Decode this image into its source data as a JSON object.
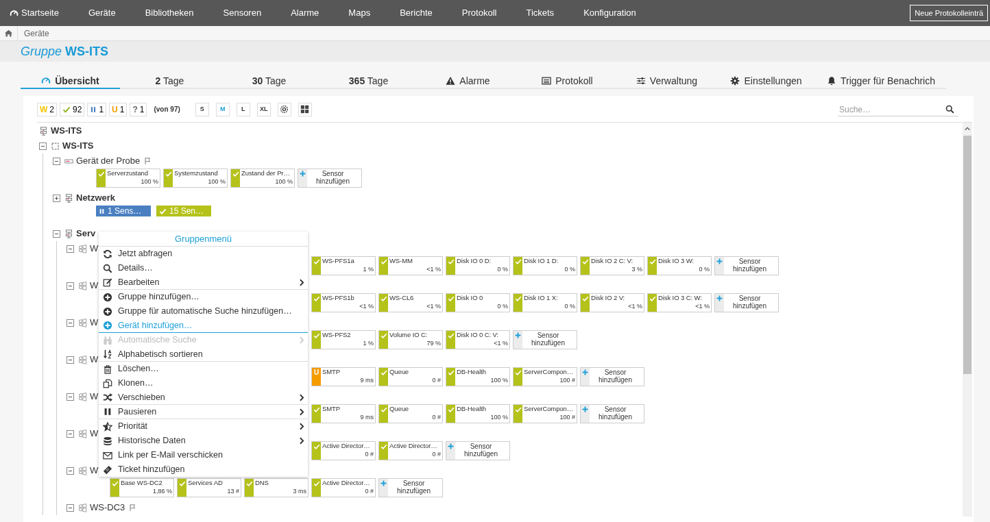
{
  "nav": {
    "home": "Startseite",
    "items": [
      "Geräte",
      "Bibliotheken",
      "Sensoren",
      "Alarme",
      "Maps",
      "Berichte",
      "Protokoll",
      "Tickets",
      "Konfiguration"
    ],
    "button": "Neue Protokolleinträ"
  },
  "breadcrumb": [
    "Geräte"
  ],
  "title": {
    "prefix": "Gruppe",
    "name": "WS-ITS"
  },
  "tabs": [
    {
      "label": "Übersicht",
      "selected": true
    },
    {
      "label": "**2** Tage",
      "selected": false
    },
    {
      "label": "**30** Tage",
      "selected": false
    },
    {
      "label": "**365** Tage",
      "selected": false
    },
    {
      "label": "Alarme",
      "selected": false
    },
    {
      "label": "Protokoll",
      "selected": false
    },
    {
      "label": "Verwaltung",
      "selected": false
    },
    {
      "label": "Einstellungen",
      "selected": false
    },
    {
      "label": "Trigger für Benachrich",
      "selected": false
    }
  ],
  "status_counts": [
    {
      "kind": "warning",
      "letter": "W",
      "count": "2"
    },
    {
      "kind": "ok",
      "count": "92"
    },
    {
      "kind": "paused",
      "count": "1"
    },
    {
      "kind": "unusual",
      "letter": "U",
      "count": "1"
    },
    {
      "kind": "unknown",
      "letter": "?",
      "count": "1"
    }
  ],
  "total": "(von 97)",
  "sizes": [
    {
      "label": "S",
      "selected": false
    },
    {
      "label": "M",
      "selected": true
    },
    {
      "label": "L",
      "selected": false
    },
    {
      "label": "XL",
      "selected": false
    }
  ],
  "search": {
    "placeholder": "Suche…"
  },
  "tree": {
    "kind": "root",
    "label": "WS-ITS",
    "children": [
      {
        "kind": "probe",
        "label": "WS-ITS",
        "expanded": true,
        "children": [
          {
            "kind": "probe_device",
            "label": "Gerät der Probe",
            "flag": true,
            "expanded": true,
            "sensors": [
              {
                "kind": "ok",
                "name": "Serverzustand",
                "value": "100 %"
              },
              {
                "kind": "ok",
                "name": "Systemzustand",
                "value": "100 %"
              },
              {
                "kind": "ok",
                "name": "Zustand der Pr…",
                "value": "100 %"
              },
              {
                "kind": "add",
                "name": "Sensor hinzufügen"
              }
            ]
          },
          {
            "kind": "group",
            "label": "Netzwerk",
            "expanded": false,
            "summary": [
              {
                "kind": "paused",
                "label": "1 Sens…"
              },
              {
                "kind": "ok",
                "label": "15 Sen…"
              }
            ]
          },
          {
            "kind": "group",
            "label": "Serv",
            "expanded": true,
            "children": [
              {
                "kind": "device",
                "label": "W",
                "expanded": true,
                "sensors": [
                  {
                    "kind": "ok",
                    "name": "WS-PFS1a",
                    "value": "1 %"
                  },
                  {
                    "kind": "ok",
                    "name": "WS-MM",
                    "value": "<1 %"
                  },
                  {
                    "kind": "ok",
                    "name": "Disk IO 0 D:",
                    "value": "0 %"
                  },
                  {
                    "kind": "ok",
                    "name": "Disk IO 1 D:",
                    "value": "0 %"
                  },
                  {
                    "kind": "ok",
                    "name": "Disk IO 2 C: V:",
                    "value": "3 %"
                  },
                  {
                    "kind": "ok",
                    "name": "Disk IO 3 W:",
                    "value": "0 %"
                  },
                  {
                    "kind": "add",
                    "name": "Sensor hinzufügen"
                  }
                ]
              },
              {
                "kind": "device",
                "label": "W",
                "expanded": true,
                "sensors": [
                  {
                    "kind": "ok",
                    "name": "WS-PFS1b",
                    "value": "<1 %"
                  },
                  {
                    "kind": "ok",
                    "name": "WS-CL6",
                    "value": "<1 %"
                  },
                  {
                    "kind": "ok",
                    "name": "Disk IO 0",
                    "value": "0 %"
                  },
                  {
                    "kind": "ok",
                    "name": "Disk IO 1 X:",
                    "value": "0 %"
                  },
                  {
                    "kind": "ok",
                    "name": "Disk IO 2 V:",
                    "value": "<1 %"
                  },
                  {
                    "kind": "ok",
                    "name": "Disk IO 3 C: W:",
                    "value": "<1 %"
                  },
                  {
                    "kind": "add",
                    "name": "Sensor hinzufügen"
                  }
                ]
              },
              {
                "kind": "device",
                "label": "W",
                "expanded": true,
                "sensors": [
                  {
                    "kind": "ok",
                    "name": "WS-PFS2",
                    "value": "1 %"
                  },
                  {
                    "kind": "ok",
                    "name": "Volume IO C:",
                    "value": "79 %"
                  },
                  {
                    "kind": "ok",
                    "name": "Disk IO 0 C: V:",
                    "value": "<1 %"
                  },
                  {
                    "kind": "add",
                    "name": "Sensor hinzufügen"
                  }
                ]
              },
              {
                "kind": "device",
                "label": "W",
                "expanded": true,
                "sensors": [
                  {
                    "kind": "unusual",
                    "letter": "U",
                    "name": "SMTP",
                    "value": "9 ms"
                  },
                  {
                    "kind": "ok",
                    "name": "Queue",
                    "value": "0 #"
                  },
                  {
                    "kind": "ok",
                    "name": "DB-Health",
                    "value": "100 %"
                  },
                  {
                    "kind": "ok",
                    "name": "ServerCompon…",
                    "value": "100 #"
                  },
                  {
                    "kind": "add",
                    "name": "Sensor hinzufügen"
                  }
                ]
              },
              {
                "kind": "device",
                "label": "W",
                "expanded": true,
                "sensors": [
                  {
                    "kind": "ok",
                    "name": "SMTP",
                    "value": "9 ms"
                  },
                  {
                    "kind": "ok",
                    "name": "Queue",
                    "value": "0 #"
                  },
                  {
                    "kind": "ok",
                    "name": "DB-Health",
                    "value": "100 %"
                  },
                  {
                    "kind": "ok",
                    "name": "ServerCompon…",
                    "value": "100 #"
                  },
                  {
                    "kind": "add",
                    "name": "Sensor hinzufügen"
                  }
                ]
              },
              {
                "kind": "device",
                "label": "W",
                "expanded": true,
                "sensors": [
                  {
                    "kind": "ok",
                    "name": "Active Director…",
                    "value": "0 #"
                  },
                  {
                    "kind": "ok",
                    "name": "Active Director…",
                    "value": "0 #"
                  },
                  {
                    "kind": "add",
                    "name": "Sensor hinzufügen"
                  }
                ]
              },
              {
                "kind": "device",
                "label": "W",
                "expanded": true,
                "sensors": [
                  {
                    "kind": "ok",
                    "name": "Base WS-DC2",
                    "value": "1,86 %"
                  },
                  {
                    "kind": "ok",
                    "name": "Services AD",
                    "value": "13 #"
                  },
                  {
                    "kind": "ok",
                    "name": "DNS",
                    "value": "3 ms"
                  },
                  {
                    "kind": "ok",
                    "name": "Active Director…",
                    "value": "0 #"
                  },
                  {
                    "kind": "add",
                    "name": "Sensor hinzufügen"
                  }
                ]
              },
              {
                "kind": "device",
                "label": "WS-DC3",
                "flag": true,
                "expanded": true
              }
            ]
          }
        ]
      }
    ]
  },
  "menu": {
    "title": "Gruppenmenü",
    "items": [
      {
        "label": "Jetzt abfragen",
        "submenu": false,
        "disabled": false,
        "selected": false,
        "separator_after": false
      },
      {
        "label": "Details…",
        "submenu": false,
        "disabled": false,
        "selected": false,
        "separator_after": false
      },
      {
        "label": "Bearbeiten",
        "submenu": true,
        "disabled": false,
        "selected": false,
        "separator_after": true
      },
      {
        "label": "Gruppe hinzufügen…",
        "submenu": false,
        "disabled": false,
        "selected": false,
        "separator_after": false
      },
      {
        "label": "Gruppe für automatische Suche hinzufügen…",
        "submenu": false,
        "disabled": false,
        "selected": false,
        "separator_after": false
      },
      {
        "label": "Gerät hinzufügen…",
        "submenu": false,
        "disabled": false,
        "selected": true,
        "separator_after": true
      },
      {
        "label": "Automatische Suche",
        "submenu": true,
        "disabled": true,
        "selected": false,
        "separator_after": false
      },
      {
        "label": "Alphabetisch sortieren",
        "submenu": false,
        "disabled": false,
        "selected": false,
        "separator_after": true
      },
      {
        "label": "Löschen…",
        "submenu": false,
        "disabled": false,
        "selected": false,
        "separator_after": false
      },
      {
        "label": "Klonen…",
        "submenu": false,
        "disabled": false,
        "selected": false,
        "separator_after": false
      },
      {
        "label": "Verschieben",
        "submenu": true,
        "disabled": false,
        "selected": false,
        "separator_after": true
      },
      {
        "label": "Pausieren",
        "submenu": true,
        "disabled": false,
        "selected": false,
        "separator_after": true
      },
      {
        "label": "Priorität",
        "submenu": true,
        "disabled": false,
        "selected": false,
        "separator_after": false
      },
      {
        "label": "Historische Daten",
        "submenu": true,
        "disabled": false,
        "selected": false,
        "separator_after": false
      },
      {
        "label": "Link per E-Mail verschicken",
        "submenu": false,
        "disabled": false,
        "selected": false,
        "separator_after": false
      },
      {
        "label": "Ticket hinzufügen",
        "submenu": false,
        "disabled": false,
        "selected": false,
        "separator_after": false
      }
    ]
  }
}
